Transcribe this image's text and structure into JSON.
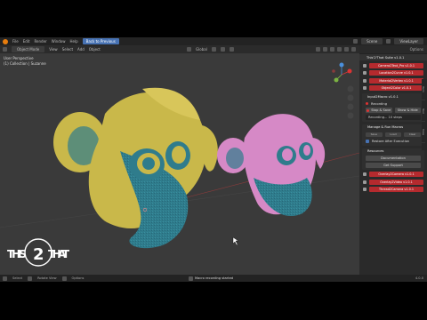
{
  "menubar": {
    "menus": [
      "File",
      "Edit",
      "Render",
      "Window",
      "Help"
    ],
    "workspace_tab": "Back to Previous",
    "scene_label": "Scene",
    "view_layer_label": "ViewLayer"
  },
  "viewport_header": {
    "mode": "Object Mode",
    "menus": [
      "View",
      "Select",
      "Add",
      "Object"
    ],
    "transform": "Global"
  },
  "viewport": {
    "view_name": "User Perspective",
    "collection": "(1) Collection | Suzanne"
  },
  "sidebar": {
    "options_label": "Options",
    "panel_title": "This'2'That Suite v1.0.1",
    "plugins": [
      "Camera2Text_Pro v1.0.1",
      "Location2Curve v1.0.1",
      "Material2Vertex v1.0.1",
      "Object2Color v1.0.1"
    ],
    "input_panel": {
      "title": "Input2Macro v1.0.1",
      "recording_label": "Recording",
      "stop_label": "Stop & Save",
      "run_label": "Show & Hide",
      "status": "Recording... 10 steps"
    },
    "manage_panel": {
      "title": "Manage & Run Macros",
      "buttons": [
        "Save",
        "Load",
        "Clear"
      ],
      "checkbox_label": "Restore After Execution"
    },
    "resources_panel": {
      "title": "Resources",
      "doc_label": "Documentation",
      "support_label": "Get Support"
    },
    "plugins_bottom": [
      "Overlay2Camera v1.0.1",
      "Overlay2Video v1.0.1",
      "Thread2Camera v1.0.1"
    ],
    "tabs": [
      "Item",
      "Tool",
      "View"
    ]
  },
  "statusbar": {
    "items": [
      "Select",
      "Rotate View",
      "Options"
    ],
    "message": "Macro recording started",
    "version": "4.0.0"
  },
  "watermark": {
    "left": "THIS",
    "mid": "2",
    "right": "THAT"
  },
  "colors": {
    "accent_red": "#b52a2e",
    "blue": "#4772b3",
    "monkey_yellow": "#c9b84a",
    "monkey_teal": "#2f7c8c",
    "monkey_pink": "#d689c6"
  }
}
